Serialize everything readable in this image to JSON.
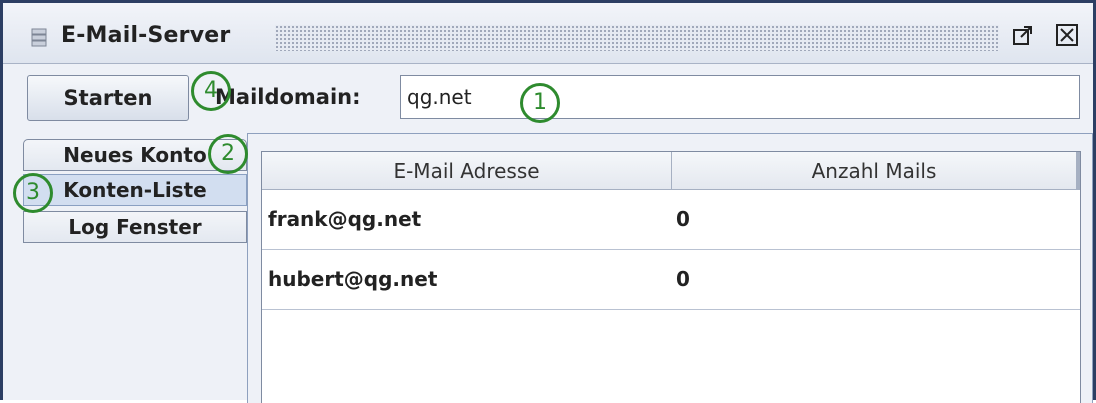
{
  "window": {
    "title": "E-Mail-Server",
    "icons": {
      "app": "server-icon",
      "maximize": "maximize-icon",
      "close": "close-icon"
    }
  },
  "toolbar": {
    "start_label": "Starten",
    "domain_label": "Maildomain:",
    "domain_value": "qg.net"
  },
  "tabs": [
    {
      "label": "Neues Konto"
    },
    {
      "label": "Konten-Liste",
      "selected": true
    },
    {
      "label": "Log Fenster"
    }
  ],
  "table": {
    "columns": [
      "E-Mail Adresse",
      "Anzahl Mails"
    ],
    "rows": [
      {
        "email": "frank@qg.net",
        "count": "0"
      },
      {
        "email": "hubert@qg.net",
        "count": "0"
      }
    ]
  },
  "callouts": [
    "1",
    "2",
    "3",
    "4"
  ],
  "colors": {
    "frame": "#2c3e63",
    "callout": "#2e8b2e",
    "selected_tab": "#d2def0"
  }
}
